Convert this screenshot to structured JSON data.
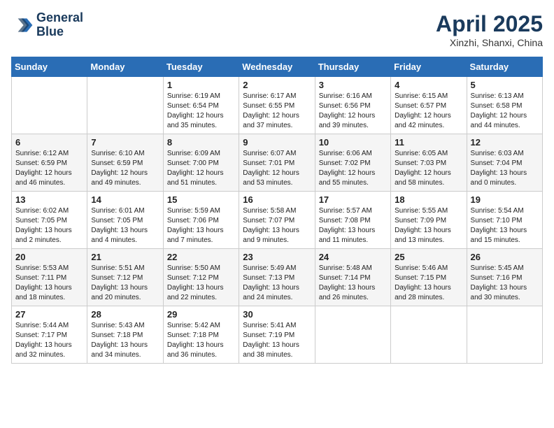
{
  "header": {
    "logo_line1": "General",
    "logo_line2": "Blue",
    "month": "April 2025",
    "location": "Xinzhi, Shanxi, China"
  },
  "weekdays": [
    "Sunday",
    "Monday",
    "Tuesday",
    "Wednesday",
    "Thursday",
    "Friday",
    "Saturday"
  ],
  "weeks": [
    [
      {
        "day": "",
        "info": ""
      },
      {
        "day": "",
        "info": ""
      },
      {
        "day": "1",
        "info": "Sunrise: 6:19 AM\nSunset: 6:54 PM\nDaylight: 12 hours\nand 35 minutes."
      },
      {
        "day": "2",
        "info": "Sunrise: 6:17 AM\nSunset: 6:55 PM\nDaylight: 12 hours\nand 37 minutes."
      },
      {
        "day": "3",
        "info": "Sunrise: 6:16 AM\nSunset: 6:56 PM\nDaylight: 12 hours\nand 39 minutes."
      },
      {
        "day": "4",
        "info": "Sunrise: 6:15 AM\nSunset: 6:57 PM\nDaylight: 12 hours\nand 42 minutes."
      },
      {
        "day": "5",
        "info": "Sunrise: 6:13 AM\nSunset: 6:58 PM\nDaylight: 12 hours\nand 44 minutes."
      }
    ],
    [
      {
        "day": "6",
        "info": "Sunrise: 6:12 AM\nSunset: 6:59 PM\nDaylight: 12 hours\nand 46 minutes."
      },
      {
        "day": "7",
        "info": "Sunrise: 6:10 AM\nSunset: 6:59 PM\nDaylight: 12 hours\nand 49 minutes."
      },
      {
        "day": "8",
        "info": "Sunrise: 6:09 AM\nSunset: 7:00 PM\nDaylight: 12 hours\nand 51 minutes."
      },
      {
        "day": "9",
        "info": "Sunrise: 6:07 AM\nSunset: 7:01 PM\nDaylight: 12 hours\nand 53 minutes."
      },
      {
        "day": "10",
        "info": "Sunrise: 6:06 AM\nSunset: 7:02 PM\nDaylight: 12 hours\nand 55 minutes."
      },
      {
        "day": "11",
        "info": "Sunrise: 6:05 AM\nSunset: 7:03 PM\nDaylight: 12 hours\nand 58 minutes."
      },
      {
        "day": "12",
        "info": "Sunrise: 6:03 AM\nSunset: 7:04 PM\nDaylight: 13 hours\nand 0 minutes."
      }
    ],
    [
      {
        "day": "13",
        "info": "Sunrise: 6:02 AM\nSunset: 7:05 PM\nDaylight: 13 hours\nand 2 minutes."
      },
      {
        "day": "14",
        "info": "Sunrise: 6:01 AM\nSunset: 7:05 PM\nDaylight: 13 hours\nand 4 minutes."
      },
      {
        "day": "15",
        "info": "Sunrise: 5:59 AM\nSunset: 7:06 PM\nDaylight: 13 hours\nand 7 minutes."
      },
      {
        "day": "16",
        "info": "Sunrise: 5:58 AM\nSunset: 7:07 PM\nDaylight: 13 hours\nand 9 minutes."
      },
      {
        "day": "17",
        "info": "Sunrise: 5:57 AM\nSunset: 7:08 PM\nDaylight: 13 hours\nand 11 minutes."
      },
      {
        "day": "18",
        "info": "Sunrise: 5:55 AM\nSunset: 7:09 PM\nDaylight: 13 hours\nand 13 minutes."
      },
      {
        "day": "19",
        "info": "Sunrise: 5:54 AM\nSunset: 7:10 PM\nDaylight: 13 hours\nand 15 minutes."
      }
    ],
    [
      {
        "day": "20",
        "info": "Sunrise: 5:53 AM\nSunset: 7:11 PM\nDaylight: 13 hours\nand 18 minutes."
      },
      {
        "day": "21",
        "info": "Sunrise: 5:51 AM\nSunset: 7:12 PM\nDaylight: 13 hours\nand 20 minutes."
      },
      {
        "day": "22",
        "info": "Sunrise: 5:50 AM\nSunset: 7:12 PM\nDaylight: 13 hours\nand 22 minutes."
      },
      {
        "day": "23",
        "info": "Sunrise: 5:49 AM\nSunset: 7:13 PM\nDaylight: 13 hours\nand 24 minutes."
      },
      {
        "day": "24",
        "info": "Sunrise: 5:48 AM\nSunset: 7:14 PM\nDaylight: 13 hours\nand 26 minutes."
      },
      {
        "day": "25",
        "info": "Sunrise: 5:46 AM\nSunset: 7:15 PM\nDaylight: 13 hours\nand 28 minutes."
      },
      {
        "day": "26",
        "info": "Sunrise: 5:45 AM\nSunset: 7:16 PM\nDaylight: 13 hours\nand 30 minutes."
      }
    ],
    [
      {
        "day": "27",
        "info": "Sunrise: 5:44 AM\nSunset: 7:17 PM\nDaylight: 13 hours\nand 32 minutes."
      },
      {
        "day": "28",
        "info": "Sunrise: 5:43 AM\nSunset: 7:18 PM\nDaylight: 13 hours\nand 34 minutes."
      },
      {
        "day": "29",
        "info": "Sunrise: 5:42 AM\nSunset: 7:18 PM\nDaylight: 13 hours\nand 36 minutes."
      },
      {
        "day": "30",
        "info": "Sunrise: 5:41 AM\nSunset: 7:19 PM\nDaylight: 13 hours\nand 38 minutes."
      },
      {
        "day": "",
        "info": ""
      },
      {
        "day": "",
        "info": ""
      },
      {
        "day": "",
        "info": ""
      }
    ]
  ]
}
